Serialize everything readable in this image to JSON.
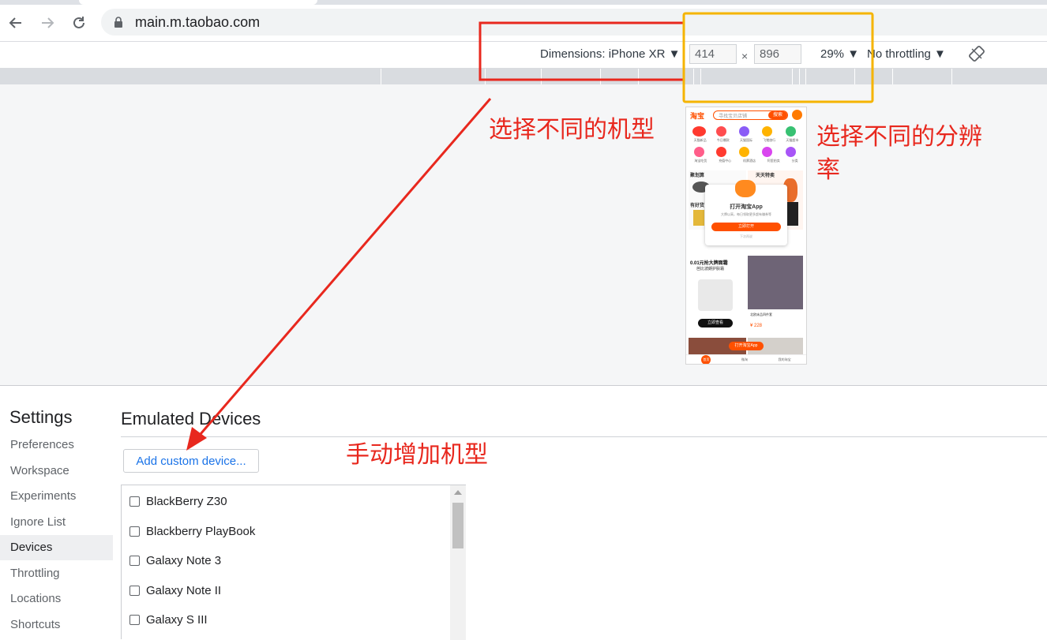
{
  "browser": {
    "url": "main.m.taobao.com"
  },
  "device_toolbar": {
    "dimensions_label": "Dimensions: iPhone XR ▼",
    "width_value": "414",
    "height_value": "896",
    "times_symbol": "×",
    "zoom_label": "29% ▼",
    "throttling_label": "No throttling ▼"
  },
  "phone_preview": {
    "logo": "淘宝",
    "search_placeholder": "寻找宝贝店铺",
    "search_button": "搜索",
    "icon_row1": [
      "天猫新品",
      "今日爆款",
      "天猫国际",
      "飞猪旅行",
      "天猫超市"
    ],
    "icon_row2": [
      "淘宝吃货",
      "充值中心",
      "机票酒店",
      "阿里拍卖",
      "分类"
    ],
    "banner_left": "聚划算",
    "banner_right": "天天特卖",
    "section_label": "有好货",
    "popup_title": "打开淘宝App",
    "popup_subtitle": "大牌以高，每日领取更多超有赚券等",
    "popup_button": "立即打开",
    "popup_skip": "下次再说",
    "card1_title": "0.01元抢大牌面霜",
    "card1_sub": "芭比波朗护肤霜",
    "card1_cta": "立即查看",
    "card2_title": "北欧床品四件套",
    "card2_price": "¥ 228",
    "float_button": "打开淘宝App",
    "tabbar": [
      "首页",
      "微淘",
      "我的淘宝"
    ]
  },
  "settings": {
    "title": "Settings",
    "nav": [
      "Preferences",
      "Workspace",
      "Experiments",
      "Ignore List",
      "Devices",
      "Throttling",
      "Locations",
      "Shortcuts"
    ],
    "active_nav": "Devices",
    "panel_title": "Emulated Devices",
    "add_button": "Add custom device...",
    "devices": [
      "BlackBerry Z30",
      "Blackberry PlayBook",
      "Galaxy Note 3",
      "Galaxy Note II",
      "Galaxy S III"
    ]
  },
  "annotations": {
    "model_label": "选择不同的机型",
    "resolution_label_line1": "选择不同的分辨",
    "resolution_label_line2": "率",
    "add_label": "手动增加机型",
    "red_color": "#e8281e",
    "yellow_color": "#f5b400"
  }
}
